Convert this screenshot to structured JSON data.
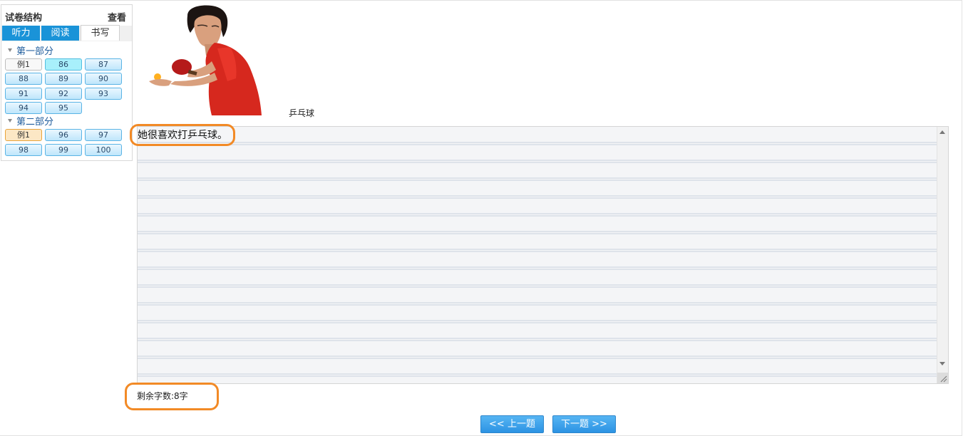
{
  "sidebar": {
    "title": "试卷结构",
    "view_link": "查看",
    "tabs": [
      {
        "label": "听力",
        "active": false
      },
      {
        "label": "阅读",
        "active": false
      },
      {
        "label": "书写",
        "active": true
      }
    ],
    "parts": [
      {
        "label": "第一部分",
        "questions": [
          "例1",
          "86",
          "87",
          "88",
          "89",
          "90",
          "91",
          "92",
          "93",
          "94",
          "95"
        ]
      },
      {
        "label": "第二部分",
        "questions": [
          "例1",
          "96",
          "97",
          "98",
          "99",
          "100"
        ]
      }
    ]
  },
  "question": {
    "image_icon": "table-tennis-player-photo",
    "caption": "乒乓球",
    "answer_text": "她很喜欢打乒乓球。",
    "remaining_words": "剩余字数:8字"
  },
  "navigation": {
    "prev_label": "<< 上一题",
    "next_label": "下一题 >>"
  },
  "colors": {
    "tab_blue": "#1a93d8",
    "current_question": "#a8f0fb",
    "selected_example": "#fce7c5",
    "highlight_orange": "#f28a26",
    "nav_button": "#3a9fe9"
  }
}
